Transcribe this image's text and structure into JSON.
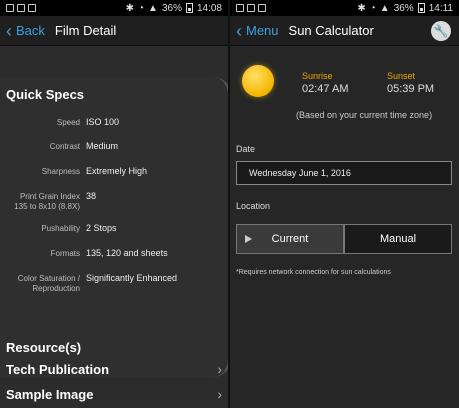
{
  "left": {
    "status": {
      "battery": "36%",
      "time": "14:08"
    },
    "nav": {
      "back_label": "Back",
      "title": "Film Detail"
    },
    "quick_specs_title": "Quick Specs",
    "specs": [
      {
        "label": "Speed",
        "value": "ISO 100"
      },
      {
        "label": "Contrast",
        "value": "Medium"
      },
      {
        "label": "Sharpness",
        "value": "Extremely High"
      },
      {
        "label": "Print Grain Index\n135 to 8x10 (8.8X)",
        "value": "38"
      },
      {
        "label": "Pushability",
        "value": "2 Stops"
      },
      {
        "label": "Formats",
        "value": "135, 120 and sheets"
      },
      {
        "label": "Color Saturation /\nReproduction",
        "value": "Significantly Enhanced"
      }
    ],
    "sections": {
      "resources": "Resource(s)",
      "tech_publication": "Tech Publication",
      "sample_image": "Sample Image"
    }
  },
  "right": {
    "status": {
      "battery": "36%",
      "time": "14:11"
    },
    "nav": {
      "back_label": "Menu",
      "title": "Sun Calculator"
    },
    "sunrise_label": "Sunrise",
    "sunrise_time": "02:47 AM",
    "sunset_label": "Sunset",
    "sunset_time": "05:39 PM",
    "tz_note": "(Based on your current time zone)",
    "date_label": "Date",
    "date_value": "Wednesday  June 1, 2016",
    "location_label": "Location",
    "location_current": "Current",
    "location_manual": "Manual",
    "requirement_note": "*Requires network connection for sun calculations"
  }
}
